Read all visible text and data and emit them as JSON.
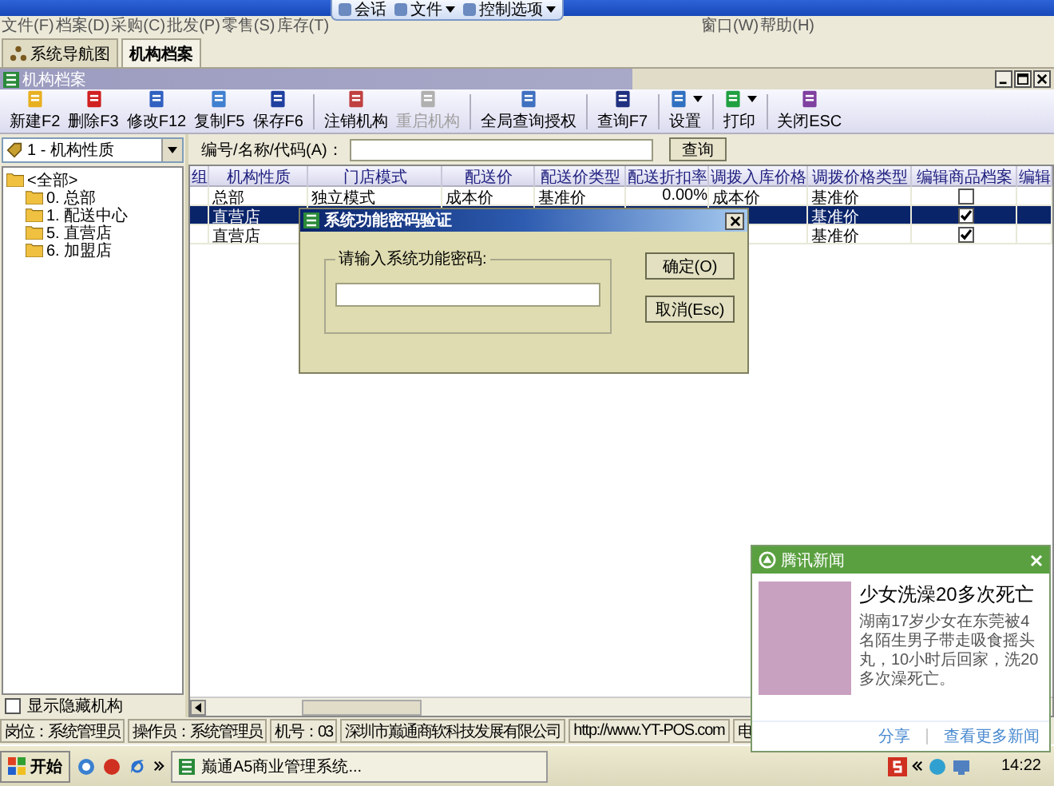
{
  "remote_toolbar": [
    {
      "label": "会话",
      "dropdown": false
    },
    {
      "label": "文件",
      "dropdown": true
    },
    {
      "label": "控制选项",
      "dropdown": true
    }
  ],
  "menu_bar": [
    "文件(F)",
    "档案(D)",
    "采购(C)",
    "批发(P)",
    "零售(S)",
    "库存(T)",
    "窗口(W)",
    "帮助(H)"
  ],
  "tabs": [
    {
      "label": "系统导航图",
      "selected": false
    },
    {
      "label": "机构档案",
      "selected": true
    }
  ],
  "document_window": {
    "title": "机构档案"
  },
  "toolbar": [
    [
      {
        "label": "新建F2",
        "disabled": false,
        "dropdown": false
      },
      {
        "label": "删除F3",
        "disabled": false,
        "dropdown": false
      },
      {
        "label": "修改F12",
        "disabled": false,
        "dropdown": false
      },
      {
        "label": "复制F5",
        "disabled": false,
        "dropdown": false
      },
      {
        "label": "保存F6",
        "disabled": false,
        "dropdown": false
      }
    ],
    [
      {
        "label": "注销机构",
        "disabled": false,
        "dropdown": false
      },
      {
        "label": "重启机构",
        "disabled": true,
        "dropdown": false
      }
    ],
    [
      {
        "label": "全局查询授权",
        "disabled": false,
        "dropdown": false
      }
    ],
    [
      {
        "label": "查询F7",
        "disabled": false,
        "dropdown": false
      }
    ],
    [
      {
        "label": "设置",
        "disabled": false,
        "dropdown": true
      }
    ],
    [
      {
        "label": "打印",
        "disabled": false,
        "dropdown": true
      }
    ],
    [
      {
        "label": "关闭ESC",
        "disabled": false,
        "dropdown": false
      }
    ]
  ],
  "filter": {
    "value": "1 - 机构性质"
  },
  "search": {
    "label": "编号/名称/代码(A)：",
    "button": "查询"
  },
  "tree": {
    "label": "<全部>",
    "expanded": true,
    "children": [
      {
        "label": "0. 总部"
      },
      {
        "label": "1. 配送中心"
      },
      {
        "label": "5. 直营店"
      },
      {
        "label": "6. 加盟店"
      }
    ]
  },
  "show_hidden": {
    "label": "显示隐藏机构",
    "checked": false
  },
  "table": {
    "columns": [
      "组",
      "机构性质",
      "门店模式",
      "配送价",
      "配送价类型",
      "配送折扣率",
      "调拨入库价格",
      "调拨价格类型",
      "编辑商品档案",
      "编辑"
    ],
    "rows": [
      {
        "selected": false,
        "cells": [
          null,
          "总部",
          "独立模式",
          "成本价",
          "基准价",
          "0.00%",
          "成本价",
          "基准价"
        ],
        "edit_goods": false
      },
      {
        "selected": true,
        "cells": [
          null,
          "直营店",
          null,
          null,
          null,
          null,
          null,
          "基准价"
        ],
        "edit_goods": true
      },
      {
        "selected": false,
        "cells": [
          null,
          "直营店",
          null,
          null,
          null,
          null,
          null,
          "基准价"
        ],
        "edit_goods": true
      }
    ]
  },
  "status_bar": [
    "岗位：系统管理员",
    "操作员：系统管理员",
    "机号：03",
    "深圳市巅通商软科技发展有限公司",
    "http://www.YT-POS.com",
    "电"
  ],
  "dialog": {
    "title": "系统功能密码验证",
    "group_label": "请输入系统功能密码:",
    "buttons": [
      "确定(O)",
      "取消(Esc)"
    ]
  },
  "taskbar": {
    "start": "开始",
    "tasks": [
      {
        "label": "巅通A5商业管理系统...",
        "selected": false
      }
    ],
    "clock": "14:22"
  },
  "news_popup": {
    "title": "腾讯新闻",
    "headline": "少女洗澡20多次死亡",
    "body": "湖南17岁少女在东莞被4名陌生男子带走吸食摇头丸，10小时后回家，洗20多次澡死亡。",
    "links": [
      "分享",
      "查看更多新闻"
    ]
  }
}
